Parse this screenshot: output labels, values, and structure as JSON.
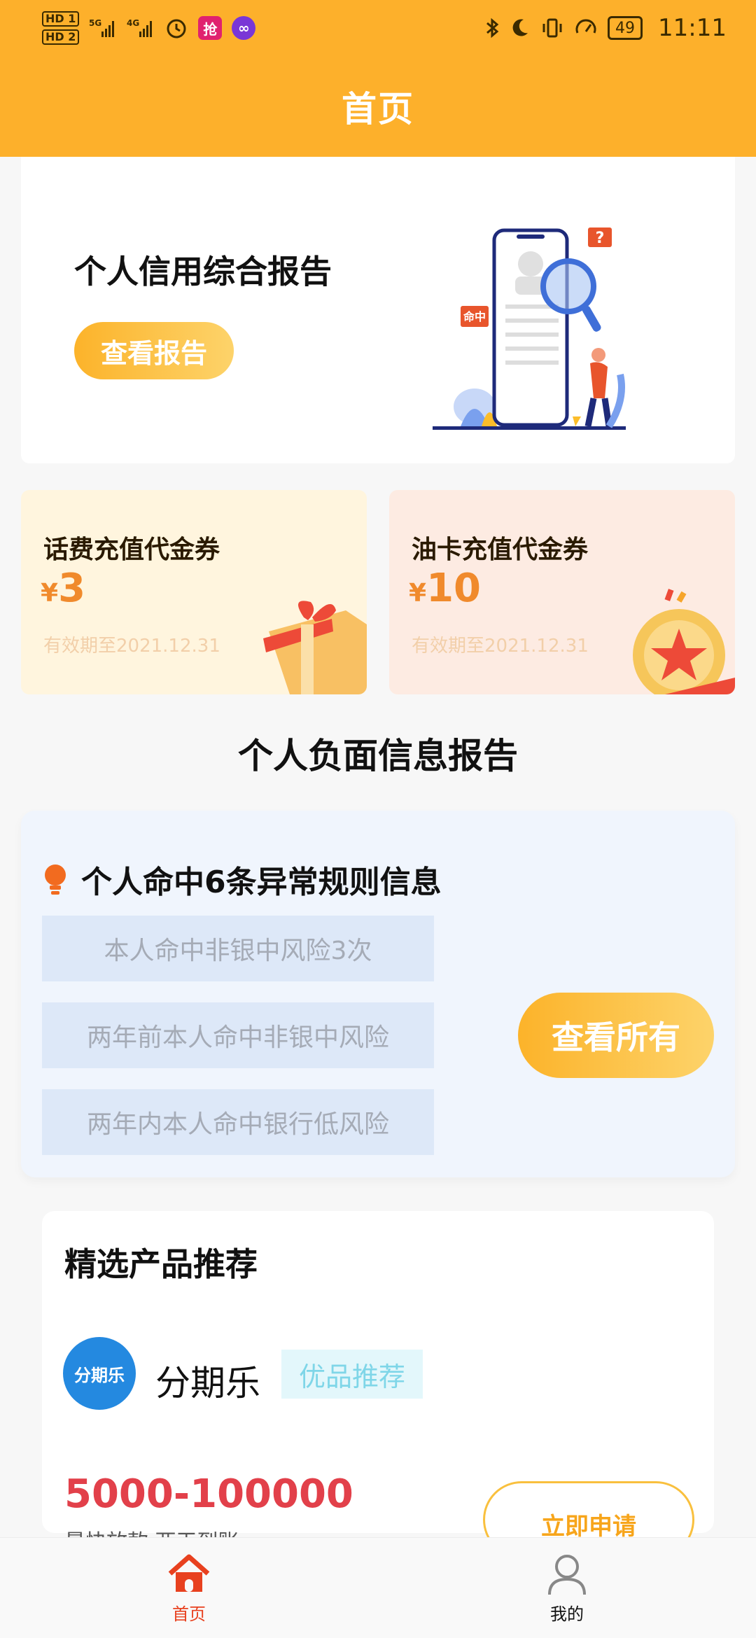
{
  "status_bar": {
    "left_icons": [
      "hd-icon",
      "signal-5g-icon",
      "signal-4g-icon",
      "alarm-icon",
      "grab-app-icon",
      "link-app-icon"
    ],
    "hd1": "HD 1",
    "hd2": "HD 2",
    "badge1": "抢",
    "badge2": "∞",
    "battery": "49",
    "time": "11:11",
    "right_icons": [
      "bluetooth-icon",
      "moon-icon",
      "vibrate-icon",
      "speed-icon",
      "battery-icon"
    ]
  },
  "header": {
    "title": "首页"
  },
  "credit_report": {
    "title": "个人信用综合报告",
    "button_label": "查看报告",
    "illustration_tag": "命中",
    "illustration_question": "?"
  },
  "coupons": [
    {
      "title": "话费充值代金券",
      "currency": "¥",
      "amount": "3",
      "expiry": "有效期至2021.12.31"
    },
    {
      "title": "油卡充值代金券",
      "currency": "¥",
      "amount": "10",
      "expiry": "有效期至2021.12.31"
    }
  ],
  "negative_section": {
    "title": "个人负面信息报告",
    "headline": "个人命中6条异常规则信息",
    "rules": [
      "本人命中非银中风险3次",
      "两年前本人命中非银中风险",
      "两年内本人命中银行低风险"
    ],
    "button_label": "查看所有"
  },
  "products": {
    "title": "精选产品推荐",
    "item": {
      "logo_text": "分期乐",
      "name": "分期乐",
      "tag": "优品推荐",
      "amount": "5000-100000",
      "subtitle": "最快放款 两天到账",
      "button_label": "立即申请"
    }
  },
  "tab_bar": {
    "tabs": [
      {
        "label": "首页",
        "active": true
      },
      {
        "label": "我的",
        "active": false
      }
    ]
  },
  "colors": {
    "brand": "#fdb02b",
    "accent_red": "#e2404a",
    "tab_active": "#e8411f"
  }
}
